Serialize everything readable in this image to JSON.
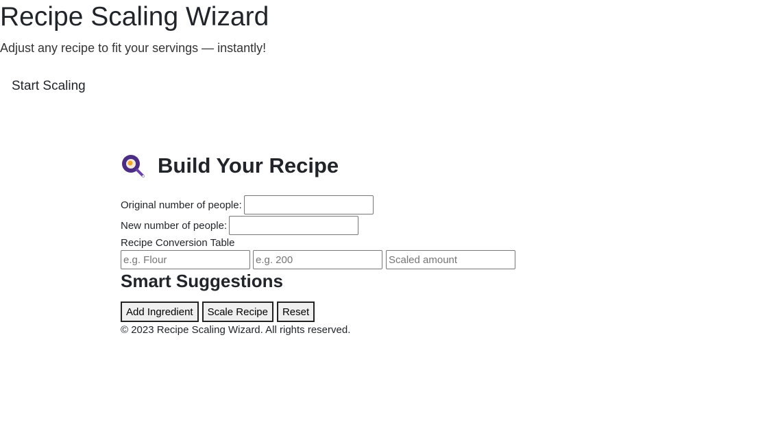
{
  "header": {
    "title": "Recipe Scaling Wizard",
    "subtitle": "Adjust any recipe to fit your servings — instantly!",
    "start_link": "Start Scaling"
  },
  "builder": {
    "icon": "frying-pan-egg-icon",
    "title": "Build Your Recipe",
    "original_label": "Original number of people:",
    "original_value": "",
    "new_label": "New number of people:",
    "new_value": "",
    "table_caption": "Recipe Conversion Table",
    "ingredient_placeholder": "e.g. Flour",
    "amount_placeholder": "e.g. 200",
    "scaled_placeholder": "Scaled amount",
    "suggestions_title": "Smart Suggestions",
    "buttons": {
      "add": "Add Ingredient",
      "scale": "Scale Recipe",
      "reset": "Reset"
    }
  },
  "footer": {
    "text": "© 2023 Recipe Scaling Wizard. All rights reserved."
  }
}
